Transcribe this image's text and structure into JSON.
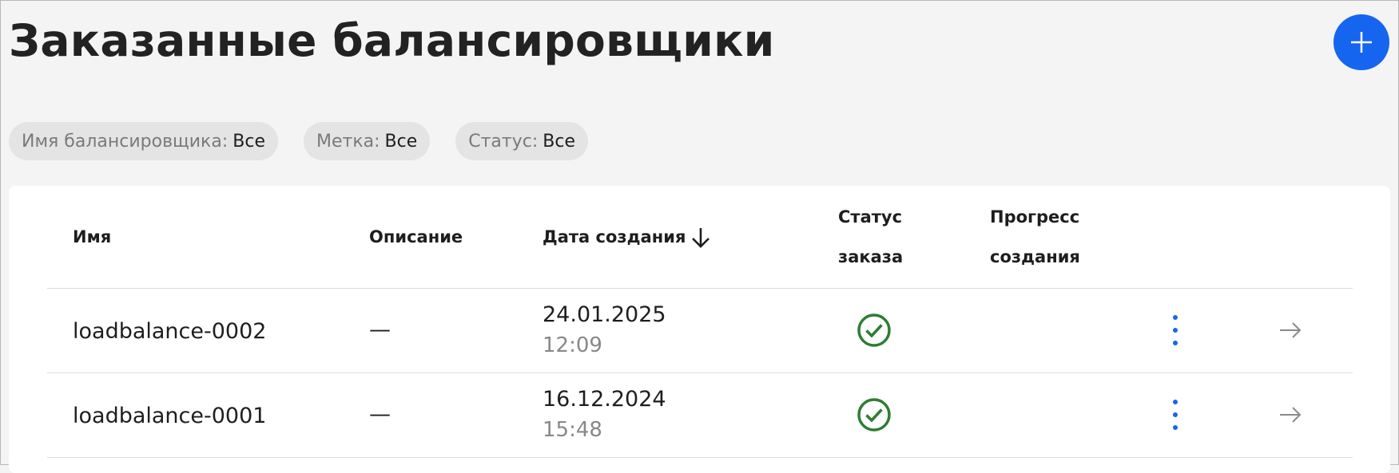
{
  "header": {
    "title": "Заказанные балансировщики",
    "add_button_icon": "plus-icon",
    "accent_color": "#1565f0"
  },
  "filters": [
    {
      "label": "Имя балансировщика:",
      "value": "Все"
    },
    {
      "label": "Метка:",
      "value": "Все"
    },
    {
      "label": "Статус:",
      "value": "Все"
    }
  ],
  "table": {
    "columns": {
      "name": "Имя",
      "description": "Описание",
      "created": "Дата создания",
      "order_status_line1": "Статус",
      "order_status_line2": "заказа",
      "progress_line1": "Прогресс",
      "progress_line2": "создания"
    },
    "sort_icon": "arrow-down-icon",
    "rows": [
      {
        "name": "loadbalance-0002",
        "description": "—",
        "date": "24.01.2025",
        "time": "12:09",
        "status_icon": "check-circle-icon",
        "status_color": "#2e7d32",
        "progress": ""
      },
      {
        "name": "loadbalance-0001",
        "description": "—",
        "date": "16.12.2024",
        "time": "15:48",
        "status_icon": "check-circle-icon",
        "status_color": "#2e7d32",
        "progress": ""
      }
    ]
  }
}
